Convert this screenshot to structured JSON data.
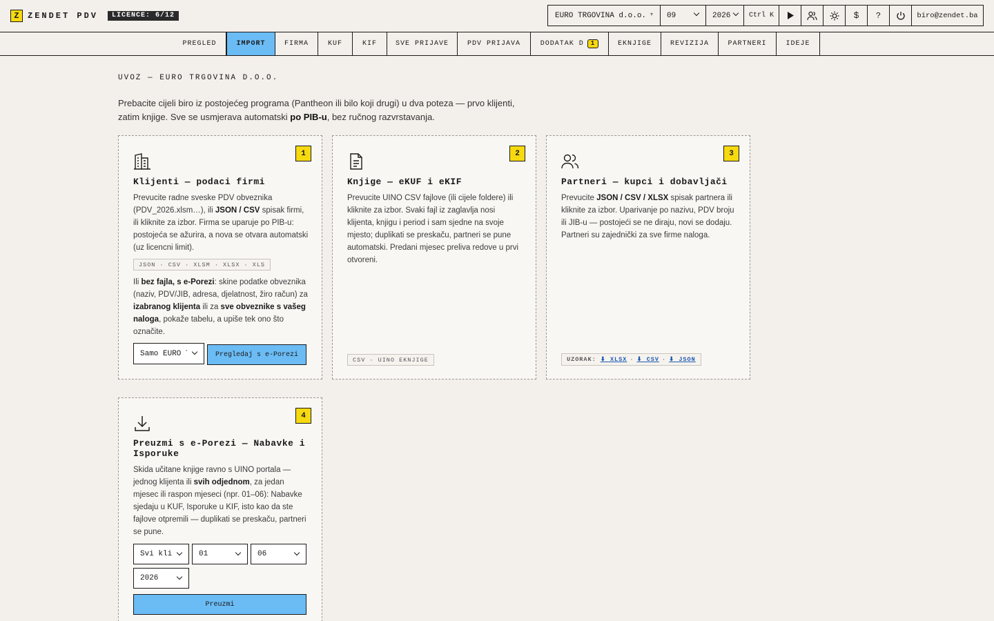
{
  "header": {
    "logo_letter": "Z",
    "app_name": "ZENDET PDV",
    "licence": "LICENCE: 6/12",
    "company": "EURO TRGOVINA d.o.o.",
    "month": "09",
    "year": "2026",
    "shortcut": "Ctrl K",
    "user": "biro@zendet.ba"
  },
  "nav": {
    "items": [
      {
        "label": "PREGLED"
      },
      {
        "label": "IMPORT"
      },
      {
        "label": "FIRMA"
      },
      {
        "label": "KUF"
      },
      {
        "label": "KIF"
      },
      {
        "label": "SVE PRIJAVE"
      },
      {
        "label": "PDV PRIJAVA"
      },
      {
        "label": "DODATAK D",
        "badge": "1"
      },
      {
        "label": "EKNJIGE"
      },
      {
        "label": "REVIZIJA"
      },
      {
        "label": "PARTNERI"
      },
      {
        "label": "IDEJE"
      }
    ]
  },
  "page": {
    "title": "UVOZ — EURO TRGOVINA D.O.O.",
    "intro_1": "Prebacite cijeli biro iz postojećeg programa (Pantheon ili bilo koji drugi) u dva poteza — prvo klijenti, zatim knjige. Sve se usmjerava automatski ",
    "intro_bold": "po PIB-u",
    "intro_2": ", bez ručnog razvrstavanja."
  },
  "cards": {
    "c1": {
      "num": "1",
      "title": "Klijenti — podaci firmi",
      "t1": "Prevucite radne sveske PDV obveznika (PDV_2026.xlsm…), ili ",
      "t1b": "JSON / CSV",
      "t1c": " spisak firmi, ili kliknite za izbor. Firma se uparuje po PIB-u: postojeća se ažurira, a nova se otvara automatski (uz licencni limit).",
      "formats": "JSON · CSV · XLSM · XLSX · XLS",
      "t2a": "Ili ",
      "t2b": "bez fajla, s e-Porezi",
      "t2c": ": skine podatke obveznika (naziv, PDV/JIB, adresa, djelatnost, žiro račun) za ",
      "t2d": "izabranog klijenta",
      "t2e": " ili za ",
      "t2f": "sve obveznike s vašeg naloga",
      "t2g": ", pokaže tabelu, a upiše tek ono što označite.",
      "select_value": "Samo EURO TRGOVINA",
      "button": "Pregledaj s e-Porezi"
    },
    "c2": {
      "num": "2",
      "title": "Knjige — eKUF i eKIF",
      "text": "Prevucite UINO CSV fajlove (ili cijele foldere) ili kliknite za izbor. Svaki fajl iz zaglavlja nosi klijenta, knjigu i period i sam sjedne na svoje mjesto; duplikati se preskaču, partneri se pune automatski. Predani mjesec preliva redove u prvi otvoreni.",
      "formats": "CSV · UINO EKNJIGE"
    },
    "c3": {
      "num": "3",
      "title": "Partneri — kupci i dobavljači",
      "t1": "Prevucite ",
      "t1b": "JSON / CSV / XLSX",
      "t1c": " spisak partnera ili kliknite za izbor. Uparivanje po nazivu, PDV broju ili JIB-u — postojeći se ne diraju, novi se dodaju. Partneri su zajednički za sve firme naloga.",
      "sample_label": "UZORAK:",
      "link_xlsx": "⬇ XLSX",
      "link_csv": "⬇ CSV",
      "link_json": "⬇ JSON"
    },
    "c4": {
      "num": "4",
      "title": "Preuzmi s e-Porezi — Nabavke i Isporuke",
      "t1": "Skida učitane knjige ravno s UINO portala — jednog klijenta ili ",
      "t1b": "svih odjednom",
      "t1c": ", za jedan mjesec ili raspon mjeseci (npr. 01–06): Nabavke sjedaju u KUF, Isporuke u KIF, isto kao da ste fajlove otpremili — duplikati se preskaču, partneri se pune.",
      "client_select": "Svi klijenti",
      "month_from": "01",
      "month_to": "06",
      "year": "2026",
      "button": "Preuzmi"
    }
  }
}
